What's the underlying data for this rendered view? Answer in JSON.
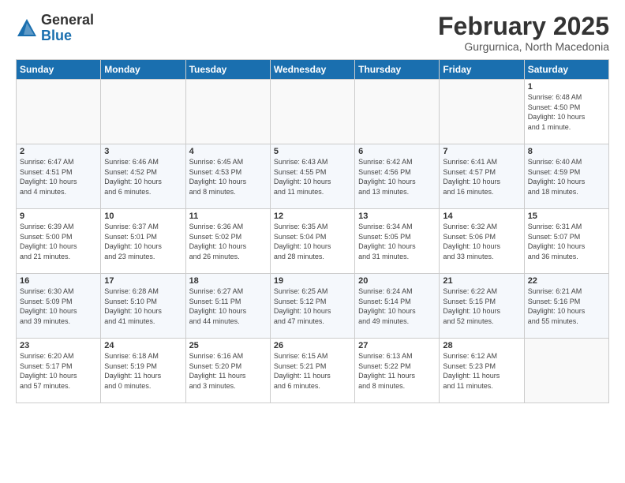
{
  "header": {
    "logo_general": "General",
    "logo_blue": "Blue",
    "title": "February 2025",
    "subtitle": "Gurgurnica, North Macedonia"
  },
  "days_of_week": [
    "Sunday",
    "Monday",
    "Tuesday",
    "Wednesday",
    "Thursday",
    "Friday",
    "Saturday"
  ],
  "weeks": [
    [
      {
        "day": "",
        "info": ""
      },
      {
        "day": "",
        "info": ""
      },
      {
        "day": "",
        "info": ""
      },
      {
        "day": "",
        "info": ""
      },
      {
        "day": "",
        "info": ""
      },
      {
        "day": "",
        "info": ""
      },
      {
        "day": "1",
        "info": "Sunrise: 6:48 AM\nSunset: 4:50 PM\nDaylight: 10 hours\nand 1 minute."
      }
    ],
    [
      {
        "day": "2",
        "info": "Sunrise: 6:47 AM\nSunset: 4:51 PM\nDaylight: 10 hours\nand 4 minutes."
      },
      {
        "day": "3",
        "info": "Sunrise: 6:46 AM\nSunset: 4:52 PM\nDaylight: 10 hours\nand 6 minutes."
      },
      {
        "day": "4",
        "info": "Sunrise: 6:45 AM\nSunset: 4:53 PM\nDaylight: 10 hours\nand 8 minutes."
      },
      {
        "day": "5",
        "info": "Sunrise: 6:43 AM\nSunset: 4:55 PM\nDaylight: 10 hours\nand 11 minutes."
      },
      {
        "day": "6",
        "info": "Sunrise: 6:42 AM\nSunset: 4:56 PM\nDaylight: 10 hours\nand 13 minutes."
      },
      {
        "day": "7",
        "info": "Sunrise: 6:41 AM\nSunset: 4:57 PM\nDaylight: 10 hours\nand 16 minutes."
      },
      {
        "day": "8",
        "info": "Sunrise: 6:40 AM\nSunset: 4:59 PM\nDaylight: 10 hours\nand 18 minutes."
      }
    ],
    [
      {
        "day": "9",
        "info": "Sunrise: 6:39 AM\nSunset: 5:00 PM\nDaylight: 10 hours\nand 21 minutes."
      },
      {
        "day": "10",
        "info": "Sunrise: 6:37 AM\nSunset: 5:01 PM\nDaylight: 10 hours\nand 23 minutes."
      },
      {
        "day": "11",
        "info": "Sunrise: 6:36 AM\nSunset: 5:02 PM\nDaylight: 10 hours\nand 26 minutes."
      },
      {
        "day": "12",
        "info": "Sunrise: 6:35 AM\nSunset: 5:04 PM\nDaylight: 10 hours\nand 28 minutes."
      },
      {
        "day": "13",
        "info": "Sunrise: 6:34 AM\nSunset: 5:05 PM\nDaylight: 10 hours\nand 31 minutes."
      },
      {
        "day": "14",
        "info": "Sunrise: 6:32 AM\nSunset: 5:06 PM\nDaylight: 10 hours\nand 33 minutes."
      },
      {
        "day": "15",
        "info": "Sunrise: 6:31 AM\nSunset: 5:07 PM\nDaylight: 10 hours\nand 36 minutes."
      }
    ],
    [
      {
        "day": "16",
        "info": "Sunrise: 6:30 AM\nSunset: 5:09 PM\nDaylight: 10 hours\nand 39 minutes."
      },
      {
        "day": "17",
        "info": "Sunrise: 6:28 AM\nSunset: 5:10 PM\nDaylight: 10 hours\nand 41 minutes."
      },
      {
        "day": "18",
        "info": "Sunrise: 6:27 AM\nSunset: 5:11 PM\nDaylight: 10 hours\nand 44 minutes."
      },
      {
        "day": "19",
        "info": "Sunrise: 6:25 AM\nSunset: 5:12 PM\nDaylight: 10 hours\nand 47 minutes."
      },
      {
        "day": "20",
        "info": "Sunrise: 6:24 AM\nSunset: 5:14 PM\nDaylight: 10 hours\nand 49 minutes."
      },
      {
        "day": "21",
        "info": "Sunrise: 6:22 AM\nSunset: 5:15 PM\nDaylight: 10 hours\nand 52 minutes."
      },
      {
        "day": "22",
        "info": "Sunrise: 6:21 AM\nSunset: 5:16 PM\nDaylight: 10 hours\nand 55 minutes."
      }
    ],
    [
      {
        "day": "23",
        "info": "Sunrise: 6:20 AM\nSunset: 5:17 PM\nDaylight: 10 hours\nand 57 minutes."
      },
      {
        "day": "24",
        "info": "Sunrise: 6:18 AM\nSunset: 5:19 PM\nDaylight: 11 hours\nand 0 minutes."
      },
      {
        "day": "25",
        "info": "Sunrise: 6:16 AM\nSunset: 5:20 PM\nDaylight: 11 hours\nand 3 minutes."
      },
      {
        "day": "26",
        "info": "Sunrise: 6:15 AM\nSunset: 5:21 PM\nDaylight: 11 hours\nand 6 minutes."
      },
      {
        "day": "27",
        "info": "Sunrise: 6:13 AM\nSunset: 5:22 PM\nDaylight: 11 hours\nand 8 minutes."
      },
      {
        "day": "28",
        "info": "Sunrise: 6:12 AM\nSunset: 5:23 PM\nDaylight: 11 hours\nand 11 minutes."
      },
      {
        "day": "",
        "info": ""
      }
    ]
  ]
}
